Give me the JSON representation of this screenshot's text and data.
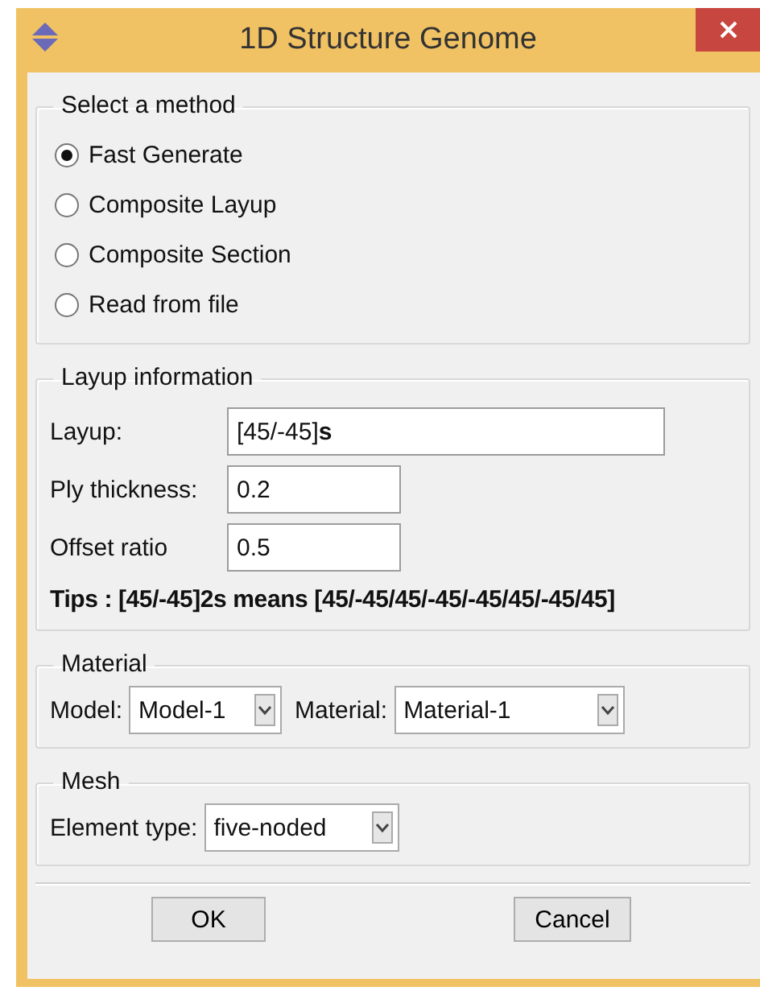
{
  "window": {
    "title": "1D Structure Genome"
  },
  "method_group": {
    "title": "Select a method",
    "options": [
      {
        "label": "Fast Generate",
        "selected": true
      },
      {
        "label": "Composite Layup",
        "selected": false
      },
      {
        "label": "Composite Section",
        "selected": false
      },
      {
        "label": "Read from file",
        "selected": false
      }
    ]
  },
  "layup_group": {
    "title": "Layup information",
    "fields": [
      {
        "label": "Layup:",
        "value": "[45/-45]**s**"
      },
      {
        "label": "Ply thickness:",
        "value": "0.2"
      },
      {
        "label": "Offset ratio",
        "value": "0.5"
      }
    ],
    "tip": "Tips : [45/-45]2s means [45/-45/45/-45/-45/45/-45/45]"
  },
  "material_group": {
    "title": "Material",
    "dropdowns": [
      {
        "label": "Model:",
        "value": "Model-1"
      },
      {
        "label": "Material:",
        "value": "Material-1"
      }
    ]
  },
  "mesh_group": {
    "title": "Mesh",
    "dropdowns": [
      {
        "label": "Element type:",
        "value": "five-noded"
      }
    ]
  },
  "buttons": [
    "OK",
    "Cancel"
  ]
}
